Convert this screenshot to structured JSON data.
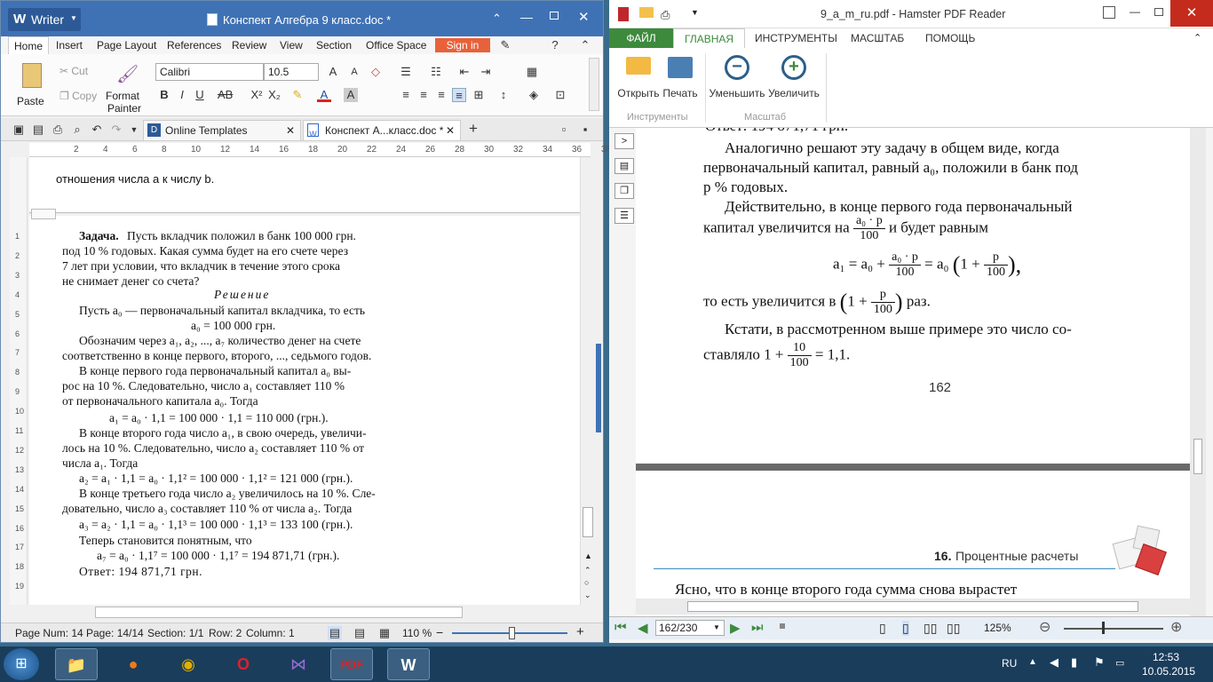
{
  "writer": {
    "app_name": "Writer",
    "doc_title": "Конспект Алгебра 9 класс.doc *",
    "menu_tabs": [
      "Home",
      "Insert",
      "Page Layout",
      "References",
      "Review",
      "View",
      "Section",
      "Office Space"
    ],
    "signin": "Sign in",
    "clipboard": {
      "paste": "Paste",
      "cut": "Cut",
      "copy": "Copy",
      "format_painter_1": "Format",
      "format_painter_2": "Painter"
    },
    "font_name": "Calibri",
    "font_size": "10.5",
    "doc_tabs": {
      "templates": "Online Templates",
      "current": "Конспект А...класс.doc *"
    },
    "ruler_marks": [
      "2",
      "4",
      "6",
      "8",
      "10",
      "12",
      "14",
      "16",
      "18",
      "20",
      "22",
      "24",
      "26",
      "28",
      "30",
      "32",
      "34",
      "36",
      "38"
    ],
    "vruler_marks": [
      "1",
      "2",
      "3",
      "4",
      "5",
      "6",
      "7",
      "8",
      "9",
      "10",
      "11",
      "12",
      "13",
      "14",
      "15",
      "16",
      "17",
      "18",
      "19"
    ],
    "page_top_line": "отношения числа а к числу b.",
    "task_bold": "Задача.",
    "lines": [
      " Пусть вкладчик положил в банк 100 000 грн.",
      "под 10 % годовых. Какая сумма будет на его счете через",
      "7 лет при условии, что вкладчик в течение этого срока",
      "не снимает денег со счета?",
      "Решение",
      "Пусть a₀ — первоначальный капитал вкладчика, то есть",
      "a₀ = 100 000 грн.",
      "Обозначим через a₁, a₂, ..., a₇ количество денег на счете",
      "соответственно в конце первого, второго, ..., седьмого годов.",
      "В конце первого года первоначальный капитал a₀ вы-",
      "рос на 10 %. Следовательно, число a₁ составляет 110 %",
      "от первоначального капитала a₀. Тогда",
      "a₁ = a₀ · 1,1 = 100 000 · 1,1 = 110 000 (грн.).",
      "В конце второго года число a₁, в свою очередь, увеличи-",
      "лось на 10 %. Следовательно, число a₂ составляет 110 % от",
      "числа a₁. Тогда",
      "a₂ = a₁ · 1,1 = a₀ · 1,1² = 100 000 · 1,1² = 121 000 (грн.).",
      "В конце третьего года число a₂ увеличилось на 10 %. Сле-",
      "довательно, число a₃ составляет 110 % от числа a₂. Тогда",
      "a₃ = a₂ · 1,1 = a₀ · 1,1³ = 100 000 · 1,1³ = 133 100 (грн.).",
      "Теперь становится понятным, что",
      "a₇ = a₀ · 1,1⁷ = 100 000 · 1,1⁷ = 194 871,71 (грн.).",
      "Ответ: 194 871,71 грн."
    ],
    "status": {
      "page_num": "Page Num: 14",
      "page": "Page: 14/14",
      "section": "Section: 1/1",
      "row": "Row: 2",
      "column": "Column: 1",
      "zoom": "110 %"
    }
  },
  "hamster": {
    "title": "9_a_m_ru.pdf - Hamster PDF Reader",
    "tabs": [
      "ФАЙЛ",
      "ГЛАВНАЯ",
      "ИНСТРУМЕНТЫ",
      "МАСШТАБ",
      "ПОМОЩЬ"
    ],
    "buttons": {
      "open": "Открыть",
      "print": "Печать",
      "zoom_out": "Уменьшить",
      "zoom_in": "Увеличить"
    },
    "groups": {
      "tools": "Инструменты",
      "scale": "Масштаб"
    },
    "pdf": {
      "cut_line": "Ответ: 194 871,71 грн.",
      "p1": [
        "Аналогично решают эту задачу в общем виде, когда",
        "первоначальный капитал, равный a₀, положили в банк под",
        "p % годовых."
      ],
      "p2": [
        "Действительно, в конце первого года первоначальный",
        "капитал увеличится на",
        "и будет равным"
      ],
      "frac_a0p": "a₀ · p",
      "frac_100": "100",
      "frac_p": "p",
      "formula_a1": "a₁ = a₀ +",
      "formula_eq": "= a₀",
      "formula_1plus": "1 +",
      "p3a": "то есть увеличится в",
      "p3b": "раз.",
      "p4": [
        "Кстати, в рассмотренном выше примере это число со-",
        "ставляло"
      ],
      "p4_frac_n": "10",
      "p4_eq": "= 1,1.",
      "one_plus": "1 +",
      "page_number": "162",
      "section_num": "16.",
      "section_title": "Процентные расчеты",
      "next_line": "Ясно, что в конце второго года сумма снова вырастет"
    },
    "nav": {
      "page": "162/230",
      "zoom": "125%"
    }
  },
  "taskbar": {
    "lang": "RU",
    "time": "12:53",
    "date": "10.05.2015"
  }
}
